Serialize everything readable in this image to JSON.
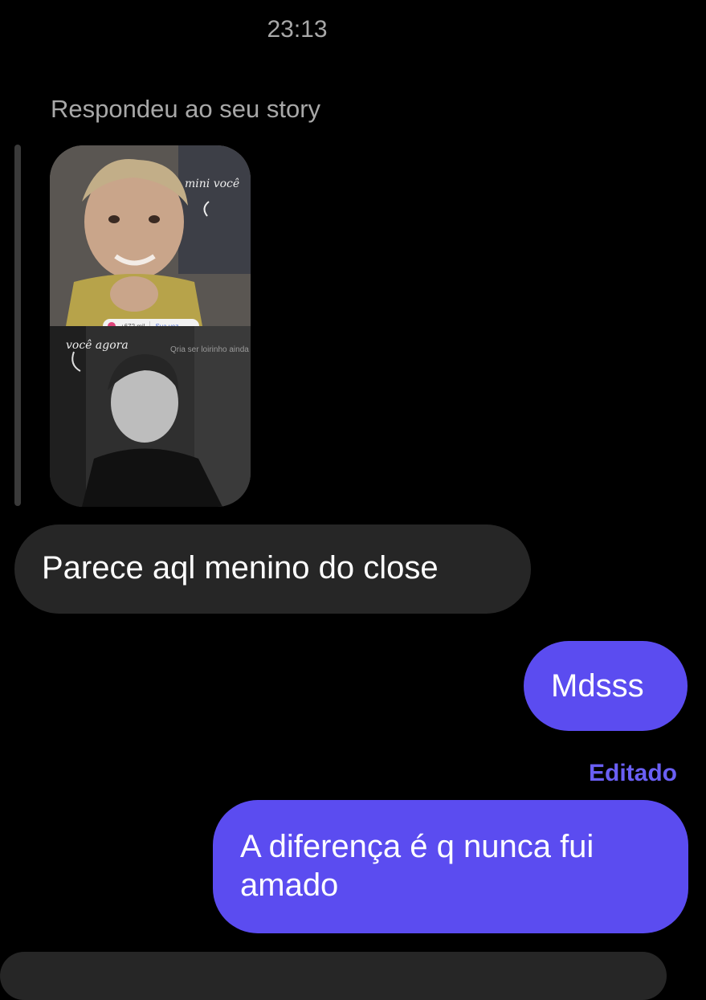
{
  "header": {
    "time": "23:13"
  },
  "story_reply": {
    "label": "Respondeu ao seu story",
    "story": {
      "caption_top": "mini você",
      "caption_bottom": "você agora",
      "overlay_text": "Qria ser loirinho ainda",
      "sticker_count": "+672 mil",
      "sticker_link": "Sua vez"
    }
  },
  "messages": [
    {
      "direction": "received",
      "text": "Parece aql menino do close"
    },
    {
      "direction": "sent",
      "text": "Mdsss"
    },
    {
      "direction": "sent",
      "text": "A diferença é q nunca fui amado",
      "edited_label": "Editado"
    }
  ],
  "colors": {
    "background": "#000000",
    "received_bubble": "#262626",
    "sent_bubble": "#5b4cf0",
    "edited_label": "#6a5ff4",
    "secondary_text": "#a8a8a8"
  }
}
